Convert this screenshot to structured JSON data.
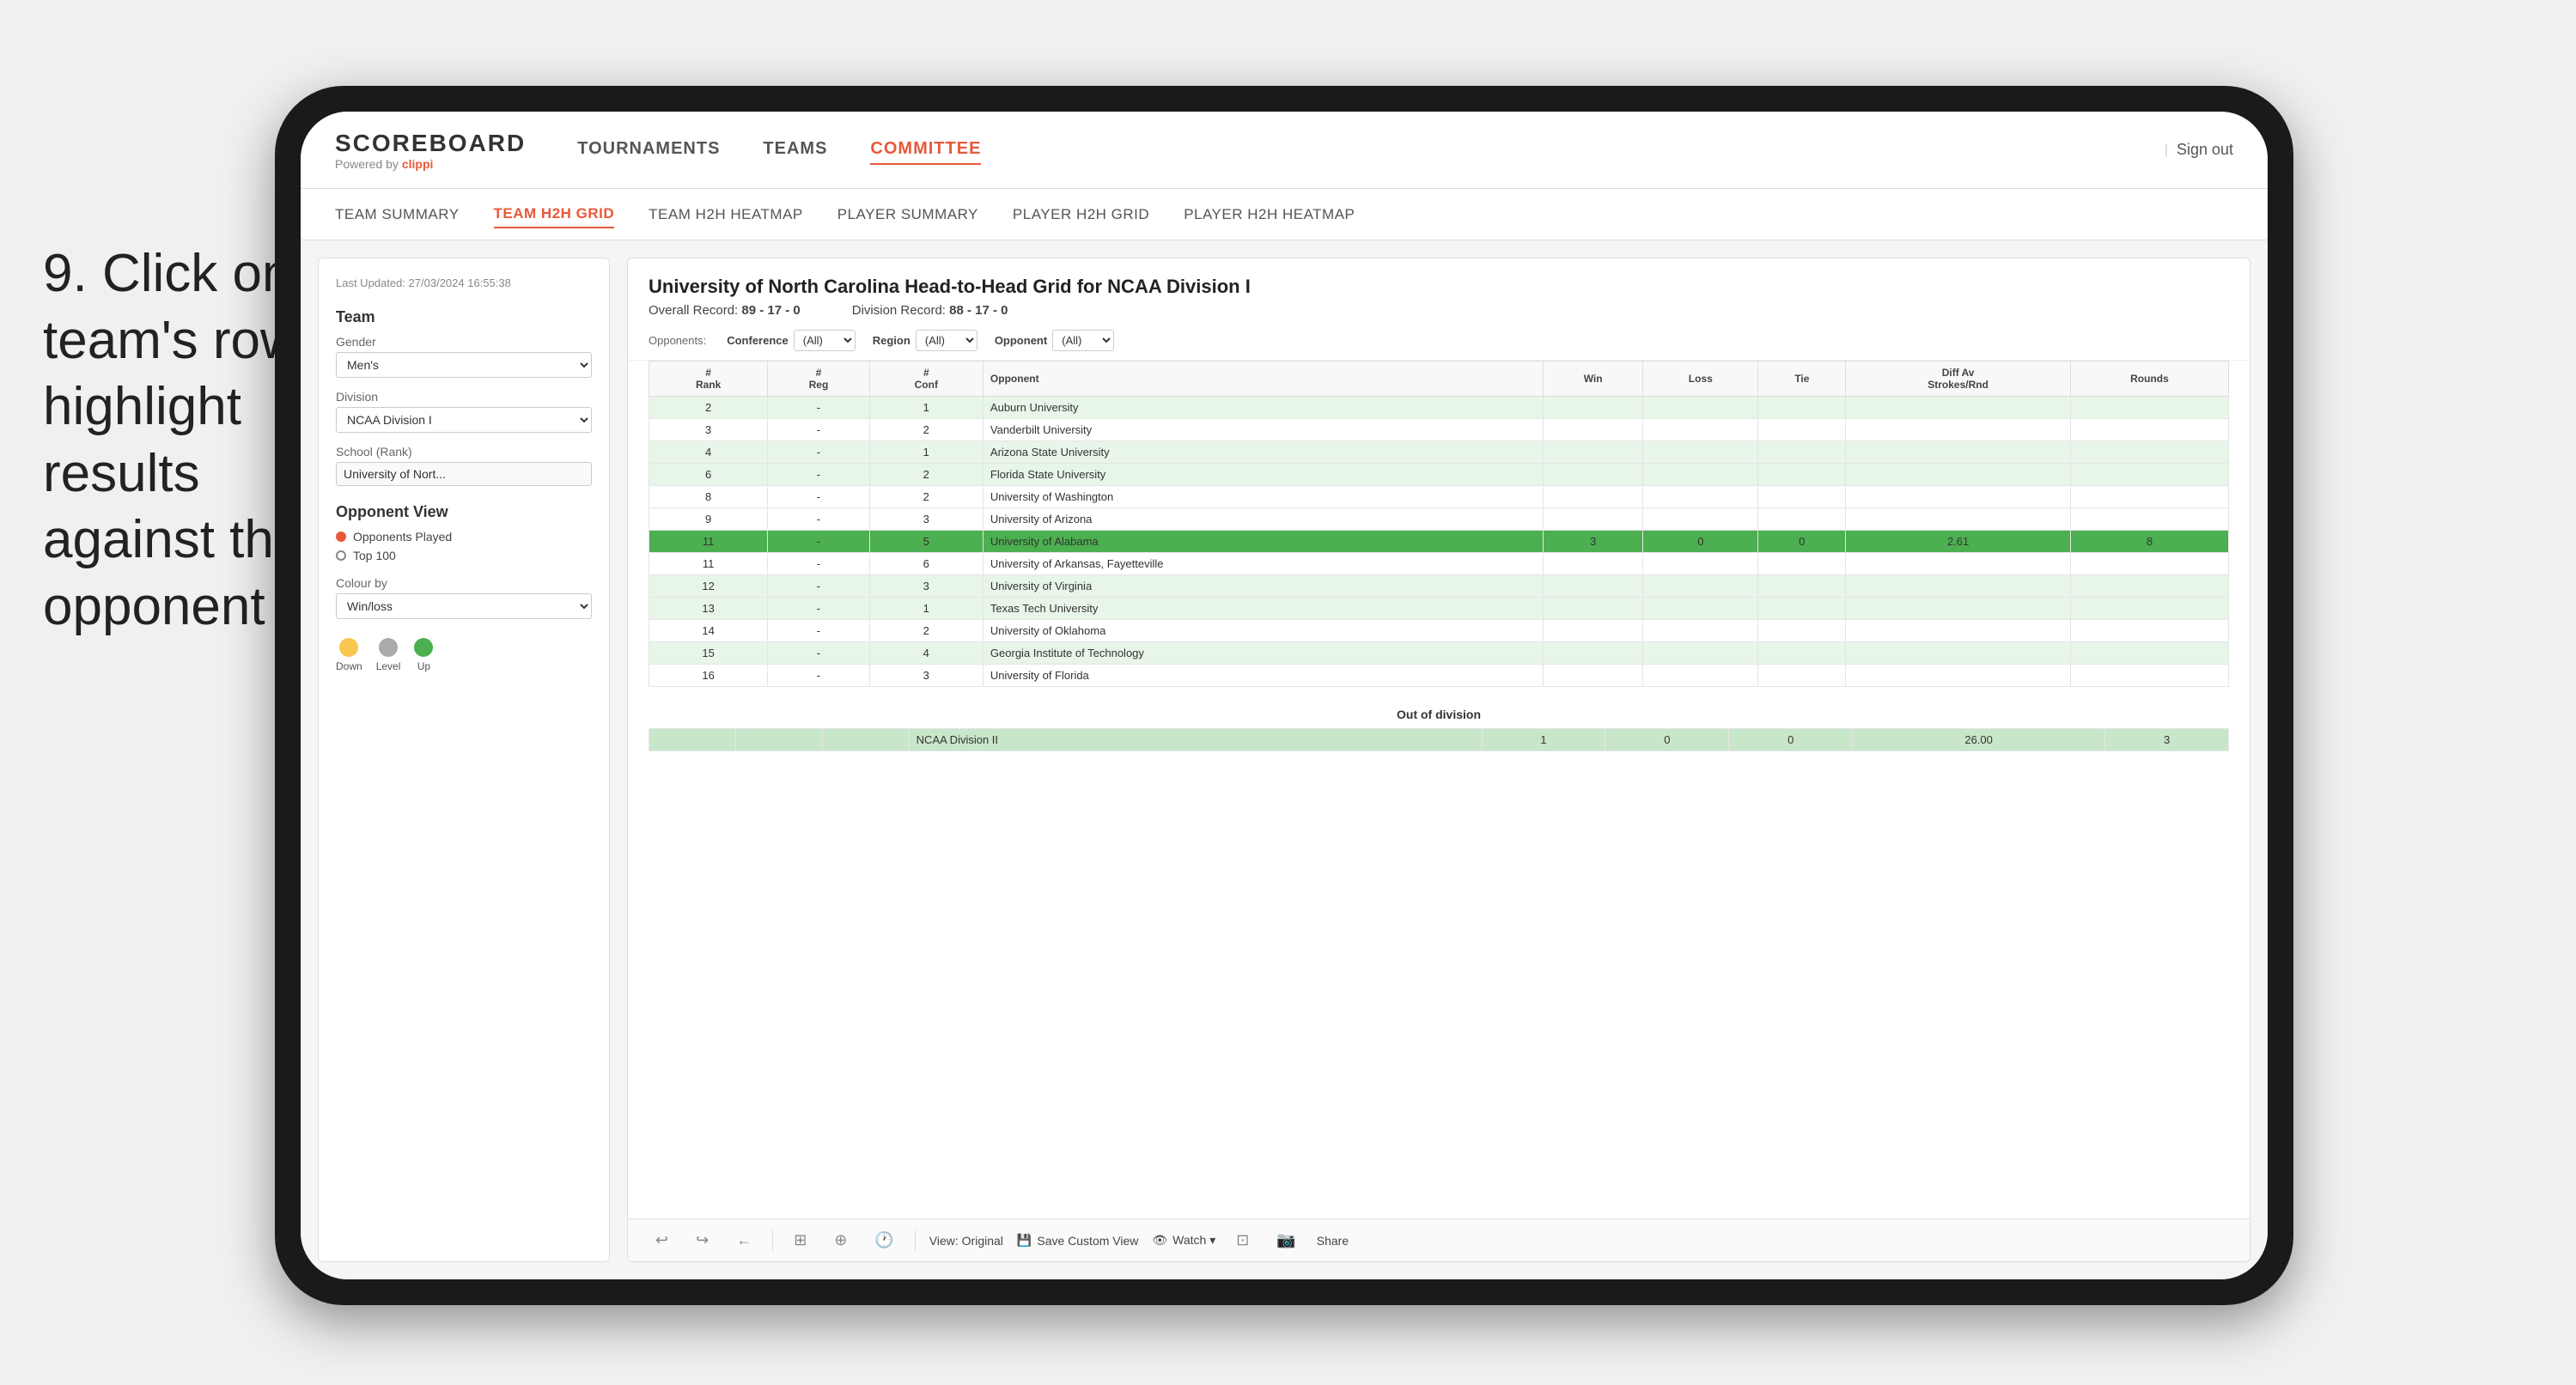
{
  "instruction": {
    "number": "9.",
    "text": "Click on a team's row to highlight results against that opponent"
  },
  "app": {
    "logo": {
      "scoreboard": "SCOREBOARD",
      "powered_by": "Powered by ",
      "clippi": "clippi"
    },
    "nav": {
      "items": [
        "TOURNAMENTS",
        "TEAMS",
        "COMMITTEE"
      ],
      "active": "COMMITTEE",
      "sign_out": "Sign out"
    },
    "subnav": {
      "items": [
        "TEAM SUMMARY",
        "TEAM H2H GRID",
        "TEAM H2H HEATMAP",
        "PLAYER SUMMARY",
        "PLAYER H2H GRID",
        "PLAYER H2H HEATMAP"
      ],
      "active": "TEAM H2H GRID"
    }
  },
  "sidebar": {
    "last_updated": "Last Updated: 27/03/2024\n16:55:38",
    "team_label": "Team",
    "gender_label": "Gender",
    "gender_value": "Men's",
    "division_label": "Division",
    "division_value": "NCAA Division I",
    "school_label": "School (Rank)",
    "school_value": "University of Nort...",
    "opponent_view_label": "Opponent View",
    "opponents_played": "Opponents Played",
    "top_100": "Top 100",
    "colour_by_label": "Colour by",
    "colour_by_value": "Win/loss",
    "legend": [
      {
        "label": "Down",
        "color": "#f9c74f"
      },
      {
        "label": "Level",
        "color": "#aaa"
      },
      {
        "label": "Up",
        "color": "#4caf50"
      }
    ]
  },
  "grid": {
    "title": "University of North Carolina Head-to-Head Grid for NCAA Division I",
    "overall_record_label": "Overall Record:",
    "overall_record": "89 - 17 - 0",
    "division_record_label": "Division Record:",
    "division_record": "88 - 17 - 0",
    "filters": {
      "opponents_label": "Opponents:",
      "conference_label": "Conference",
      "conference_value": "(All)",
      "region_label": "Region",
      "region_value": "(All)",
      "opponent_label": "Opponent",
      "opponent_value": "(All)"
    },
    "columns": [
      "#\nRank",
      "#\nReg",
      "#\nConf",
      "Opponent",
      "Win",
      "Loss",
      "Tie",
      "Diff Av\nStrokes/Rnd",
      "Rounds"
    ],
    "rows": [
      {
        "rank": "2",
        "reg": "-",
        "conf": "1",
        "opponent": "Auburn University",
        "win": "",
        "loss": "",
        "tie": "",
        "diff": "",
        "rounds": "",
        "style": "light-green"
      },
      {
        "rank": "3",
        "reg": "-",
        "conf": "2",
        "opponent": "Vanderbilt University",
        "win": "",
        "loss": "",
        "tie": "",
        "diff": "",
        "rounds": "",
        "style": "normal"
      },
      {
        "rank": "4",
        "reg": "-",
        "conf": "1",
        "opponent": "Arizona State University",
        "win": "",
        "loss": "",
        "tie": "",
        "diff": "",
        "rounds": "",
        "style": "light-green"
      },
      {
        "rank": "6",
        "reg": "-",
        "conf": "2",
        "opponent": "Florida State University",
        "win": "",
        "loss": "",
        "tie": "",
        "diff": "",
        "rounds": "",
        "style": "light-green"
      },
      {
        "rank": "8",
        "reg": "-",
        "conf": "2",
        "opponent": "University of Washington",
        "win": "",
        "loss": "",
        "tie": "",
        "diff": "",
        "rounds": "",
        "style": "normal"
      },
      {
        "rank": "9",
        "reg": "-",
        "conf": "3",
        "opponent": "University of Arizona",
        "win": "",
        "loss": "",
        "tie": "",
        "diff": "",
        "rounds": "",
        "style": "normal"
      },
      {
        "rank": "11",
        "reg": "-",
        "conf": "5",
        "opponent": "University of Alabama",
        "win": "3",
        "loss": "0",
        "tie": "0",
        "diff": "2.61",
        "rounds": "8",
        "style": "highlighted"
      },
      {
        "rank": "11",
        "reg": "-",
        "conf": "6",
        "opponent": "University of Arkansas, Fayetteville",
        "win": "",
        "loss": "",
        "tie": "",
        "diff": "",
        "rounds": "",
        "style": "normal"
      },
      {
        "rank": "12",
        "reg": "-",
        "conf": "3",
        "opponent": "University of Virginia",
        "win": "",
        "loss": "",
        "tie": "",
        "diff": "",
        "rounds": "",
        "style": "light-green"
      },
      {
        "rank": "13",
        "reg": "-",
        "conf": "1",
        "opponent": "Texas Tech University",
        "win": "",
        "loss": "",
        "tie": "",
        "diff": "",
        "rounds": "",
        "style": "light-green"
      },
      {
        "rank": "14",
        "reg": "-",
        "conf": "2",
        "opponent": "University of Oklahoma",
        "win": "",
        "loss": "",
        "tie": "",
        "diff": "",
        "rounds": "",
        "style": "normal"
      },
      {
        "rank": "15",
        "reg": "-",
        "conf": "4",
        "opponent": "Georgia Institute of Technology",
        "win": "",
        "loss": "",
        "tie": "",
        "diff": "",
        "rounds": "",
        "style": "light-green"
      },
      {
        "rank": "16",
        "reg": "-",
        "conf": "3",
        "opponent": "University of Florida",
        "win": "",
        "loss": "",
        "tie": "",
        "diff": "",
        "rounds": "",
        "style": "normal"
      }
    ],
    "out_division_label": "Out of division",
    "out_division_row": {
      "label": "NCAA Division II",
      "win": "1",
      "loss": "0",
      "tie": "0",
      "diff": "26.00",
      "rounds": "3"
    }
  },
  "toolbar": {
    "undo": "↩",
    "redo": "↪",
    "back": "←",
    "view_original": "View: Original",
    "save_custom": "Save Custom View",
    "watch": "Watch ▾",
    "share": "Share"
  }
}
